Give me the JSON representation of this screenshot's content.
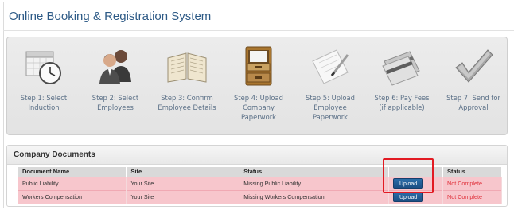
{
  "app": {
    "title": "Online Booking & Registration System"
  },
  "steps": [
    {
      "label": "Step 1: Select\nInduction",
      "icon": "calendar-clock-icon"
    },
    {
      "label": "Step 2: Select\nEmployees",
      "icon": "people-icon"
    },
    {
      "label": "Step 3: Confirm\nEmployee Details",
      "icon": "open-book-icon"
    },
    {
      "label": "Step 4: Upload\nCompany Paperwork",
      "icon": "file-drawer-icon"
    },
    {
      "label": "Step 5: Upload\nEmployee Paperwork",
      "icon": "paper-pen-icon"
    },
    {
      "label": "Step 6: Pay Fees\n(if applicable)",
      "icon": "credit-card-icon"
    },
    {
      "label": "Step 7: Send for\nApproval",
      "icon": "checkmark-icon"
    }
  ],
  "company_documents": {
    "title": "Company Documents",
    "columns": [
      "Document Name",
      "Site",
      "Status",
      "",
      "Status"
    ],
    "rows": [
      {
        "name": "Public Liability",
        "site": "Your Site",
        "status": "Missing Public Liability",
        "action": "Upload",
        "completion": "Not Complete"
      },
      {
        "name": "Workers Compensation",
        "site": "Your Site",
        "status": "Missing Workers Compensation",
        "action": "Upload",
        "completion": "Not Complete"
      }
    ]
  },
  "colors": {
    "title": "#2d5a86",
    "row_background": "#f7c6cc",
    "not_complete": "#e0303a",
    "upload_button": "#1c4f84",
    "highlight": "#e21b23"
  }
}
